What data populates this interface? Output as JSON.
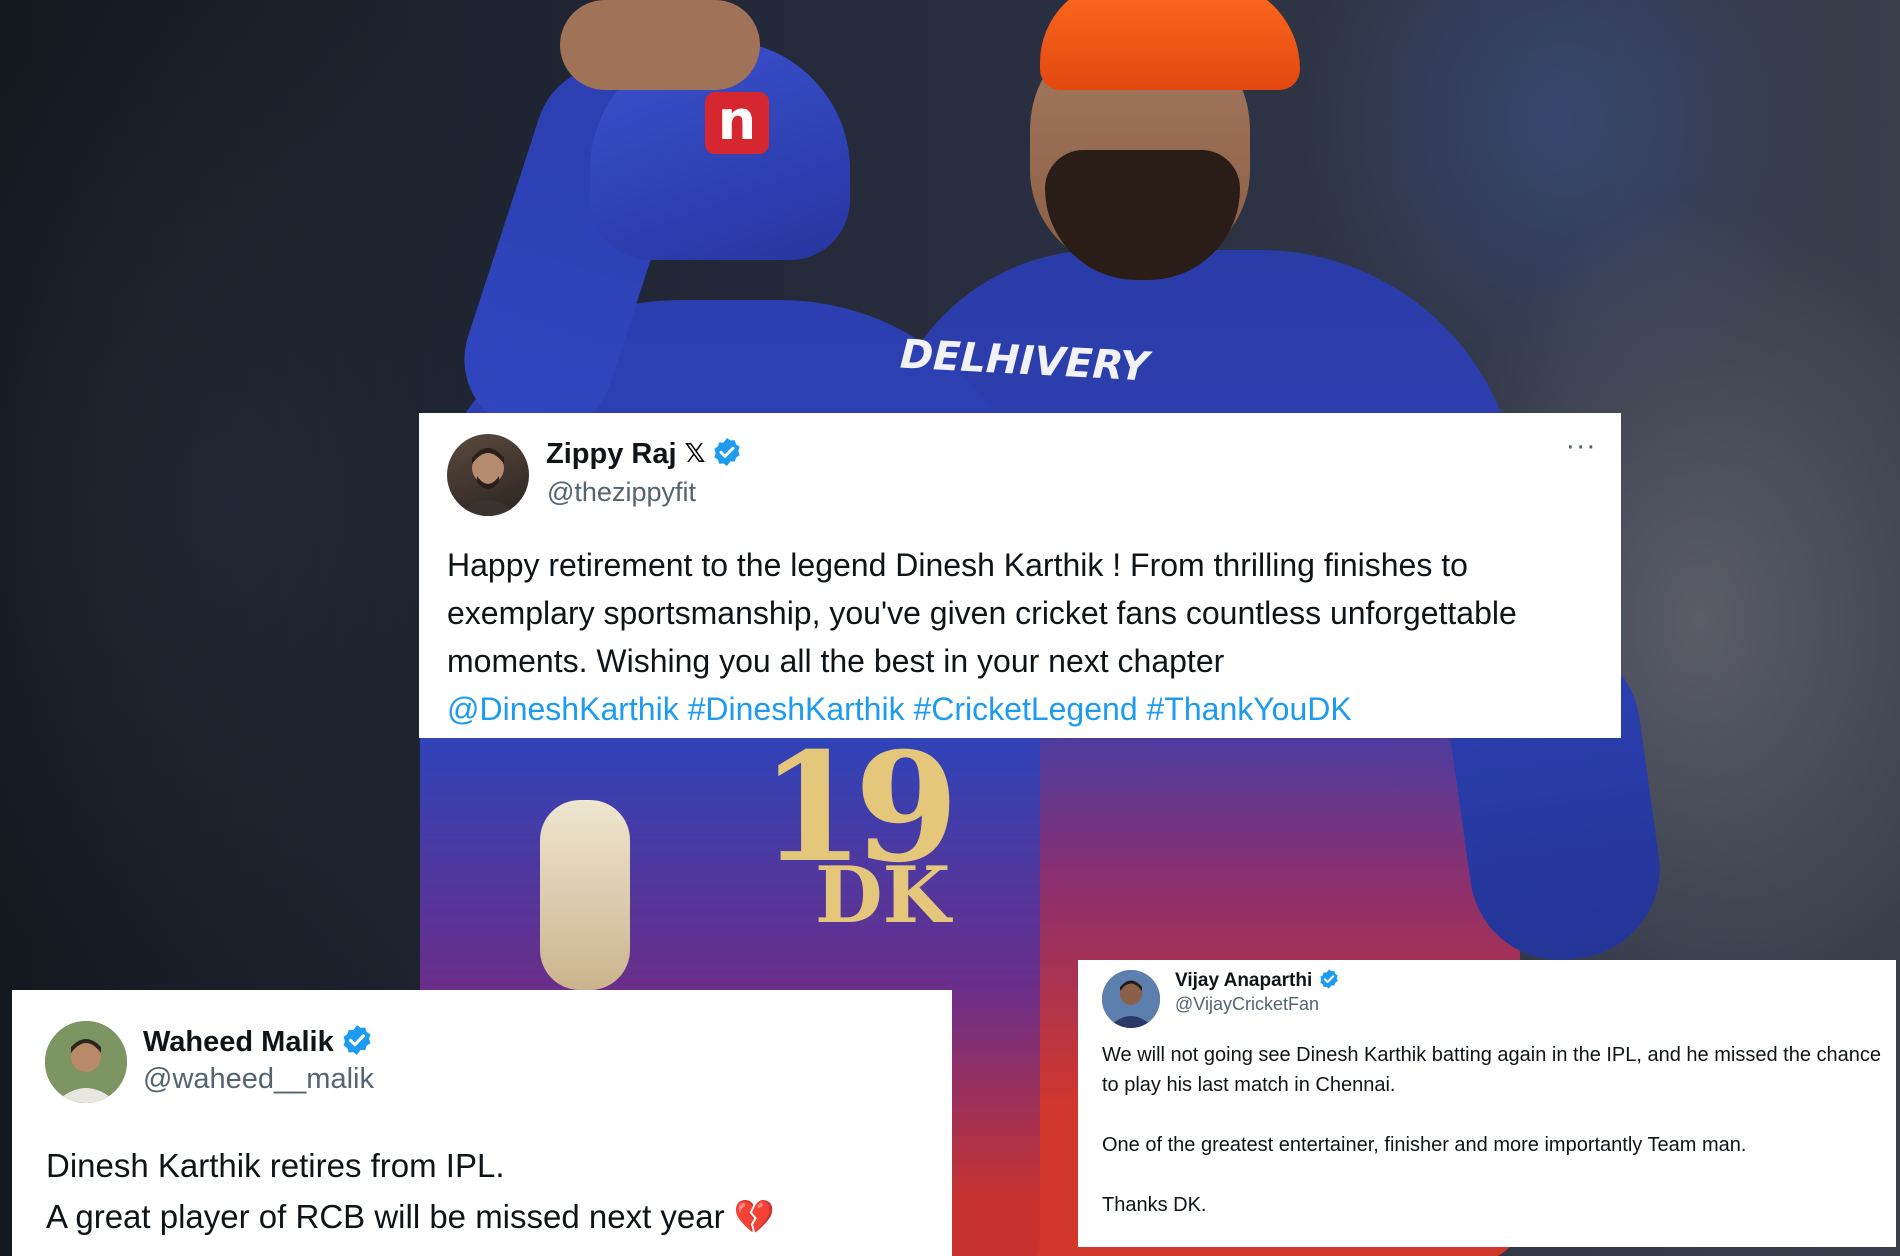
{
  "background": {
    "cap_logo": "n",
    "jersey_number": "19",
    "jersey_name": "DK",
    "sponsor_text": "DELHIVERY"
  },
  "tweets": {
    "main": {
      "name": "Zippy Raj",
      "name_suffix": "𝕏",
      "handle": "@thezippyfit",
      "more": "···",
      "text": "Happy retirement to the legend Dinesh Karthik ! From thrilling finishes to exemplary sportsmanship, you've given cricket fans countless unforgettable moments. Wishing you all the best in your next chapter",
      "links": [
        "@DineshKarthik",
        "#DineshKarthik",
        "#CricketLegend",
        "#ThankYouDK"
      ]
    },
    "left": {
      "name": "Waheed Malik",
      "handle": "@waheed__malik",
      "line1": "Dinesh Karthik retires from IPL.",
      "line2": "A great player of RCB will be missed next year",
      "emoji": "💔"
    },
    "right": {
      "name": "Vijay Anaparthi",
      "handle": "@VijayCricketFan",
      "para1": "We will not going see Dinesh Karthik batting again in the IPL, and he missed the chance to play his last match in Chennai.",
      "para2": "One of the greatest entertainer, finisher and more importantly Team man.",
      "para3": "Thanks DK."
    }
  },
  "colors": {
    "link": "#1d9bf0",
    "verified": "#1d9bf0",
    "handle": "#536471"
  },
  "icons": {
    "verified": "verified-badge-icon",
    "more": "more-options-icon"
  }
}
